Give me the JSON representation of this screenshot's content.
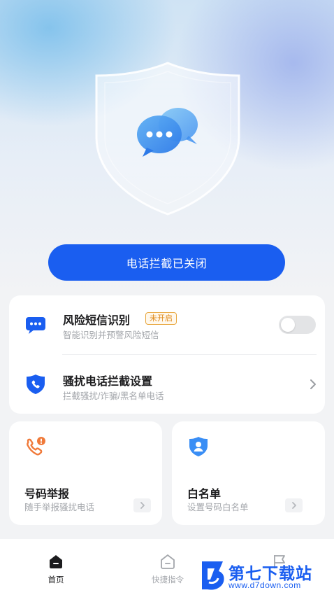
{
  "hero": {
    "action_button_label": "电话拦截已关闭"
  },
  "settings": {
    "risk_sms": {
      "title": "风险短信识别",
      "badge": "未开启",
      "subtitle": "智能识别并预警风险短信",
      "toggle_on": false
    },
    "harass_call": {
      "title": "骚扰电话拦截设置",
      "subtitle": "拦截骚扰/诈骗/黑名单电话"
    }
  },
  "cards": {
    "report": {
      "title": "号码举报",
      "subtitle": "随手举报骚扰电话"
    },
    "whitelist": {
      "title": "白名单",
      "subtitle": "设置号码白名单"
    }
  },
  "bottom_nav": {
    "items": [
      {
        "label": "首页",
        "active": true
      },
      {
        "label": "快捷指令",
        "active": false
      },
      {
        "label": "",
        "active": false
      }
    ]
  },
  "watermark": {
    "name": "第七下载站",
    "url": "www.d7down.com"
  },
  "colors": {
    "primary": "#1a5ef0",
    "badge_orange": "#e08a1a"
  }
}
